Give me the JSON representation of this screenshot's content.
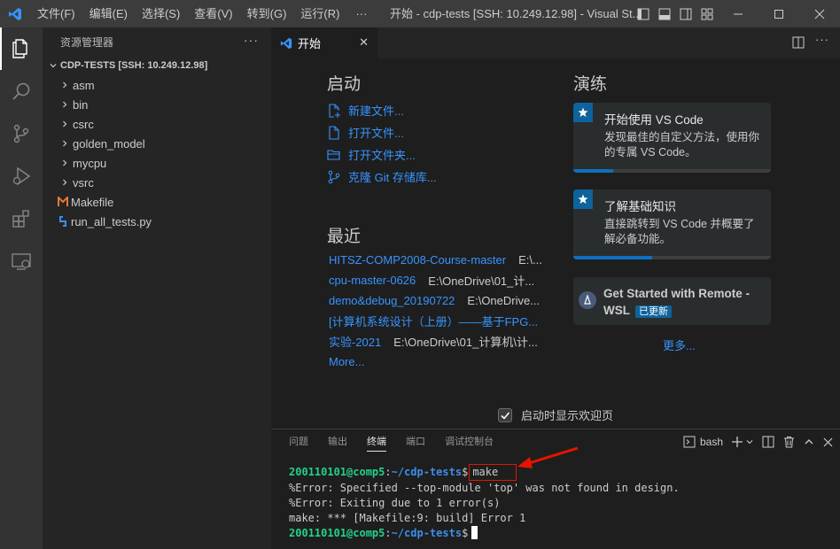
{
  "titlebar": {
    "logo_icon": "vscode-logo-icon",
    "menu": [
      "文件(F)",
      "编辑(E)",
      "选择(S)",
      "查看(V)",
      "转到(G)",
      "运行(R)"
    ],
    "more": "···",
    "title": "开始 - cdp-tests [SSH: 10.249.12.98] - Visual St..."
  },
  "activitybar": {
    "items": [
      "explorer-icon",
      "search-icon",
      "source-control-icon",
      "run-debug-icon",
      "extensions-icon",
      "remote-explorer-icon"
    ]
  },
  "sidebar": {
    "header": "资源管理器",
    "header_more": "···",
    "section": "CDP-TESTS [SSH: 10.249.12.98]",
    "items": [
      {
        "label": "asm",
        "kind": "folder"
      },
      {
        "label": "bin",
        "kind": "folder"
      },
      {
        "label": "csrc",
        "kind": "folder"
      },
      {
        "label": "golden_model",
        "kind": "folder"
      },
      {
        "label": "mycpu",
        "kind": "folder"
      },
      {
        "label": "vsrc",
        "kind": "folder"
      },
      {
        "label": "Makefile",
        "kind": "makefile"
      },
      {
        "label": "run_all_tests.py",
        "kind": "python"
      }
    ]
  },
  "editor": {
    "tab_label": "开始",
    "tab_close": "✕",
    "start_heading": "启动",
    "start_links": [
      "新建文件...",
      "打开文件...",
      "打开文件夹...",
      "克隆 Git 存储库..."
    ],
    "recent_heading": "最近",
    "recent": [
      {
        "name": "HITSZ-COMP2008-Course-master",
        "path": "E:\\..."
      },
      {
        "name": "cpu-master-0626",
        "path": "E:\\OneDrive\\01_计..."
      },
      {
        "name": "demo&debug_20190722",
        "path": "E:\\OneDrive..."
      },
      {
        "name": "[计算机系统设计（上册）——基于FPG...",
        "path": ""
      },
      {
        "name": "实验-2021",
        "path": "E:\\OneDrive\\01_计算机\\计..."
      }
    ],
    "recent_more": "More...",
    "walkthrough_heading": "演练",
    "walkthroughs": [
      {
        "title": "开始使用 VS Code",
        "desc": "发现最佳的自定义方法，使用你的专属 VS Code。",
        "progress": 0.2
      },
      {
        "title": "了解基础知识",
        "desc": "直接跳转到 VS Code 并概要了解必备功能。",
        "progress": 0.4
      }
    ],
    "wsl_card": {
      "title": "Get Started with Remote - WSL",
      "badge": "已更新"
    },
    "walk_more": "更多...",
    "startup_checkbox": "启动时显示欢迎页"
  },
  "panel": {
    "tabs": [
      "问题",
      "输出",
      "终端",
      "端口",
      "调试控制台"
    ],
    "active_tab": "终端",
    "shell": "bash",
    "terminal": {
      "user": "200110101@comp5",
      "path": "~/cdp-tests",
      "prompt_char": "$",
      "command": "make",
      "lines": [
        "%Error: Specified --top-module 'top' was not found in design.",
        "%Error: Exiting due to 1 error(s)",
        "make: *** [Makefile:9: build] Error 1"
      ]
    }
  },
  "colors": {
    "accent": "#0e639c",
    "link": "#3794ff",
    "terminal_user": "#23d18b",
    "terminal_path": "#3b8eea",
    "annotation": "#e51400"
  }
}
